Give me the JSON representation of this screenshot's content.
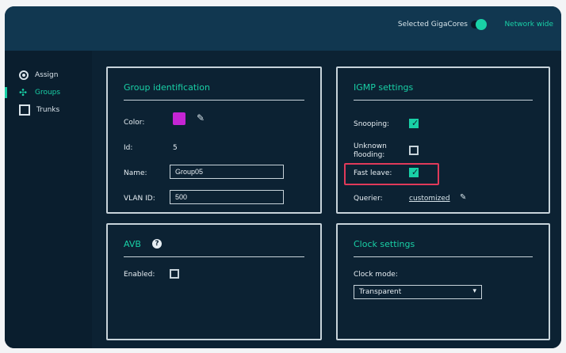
{
  "header": {
    "selected_label": "Selected GigaCores",
    "toggle_label": "Network wide"
  },
  "sidebar": {
    "items": [
      {
        "label": "Assign",
        "icon": "target-icon"
      },
      {
        "label": "Groups",
        "icon": "groups-icon"
      },
      {
        "label": "Trunks",
        "icon": "trunk-icon"
      }
    ],
    "active": "Groups"
  },
  "group_identification": {
    "title": "Group identification",
    "color_label": "Color:",
    "color_value": "#c525d4",
    "id_label": "Id:",
    "id_value": "5",
    "name_label": "Name:",
    "name_value": "Group05",
    "vlan_label": "VLAN ID:",
    "vlan_value": "500"
  },
  "igmp_settings": {
    "title": "IGMP settings",
    "snooping_label": "Snooping:",
    "snooping_checked": true,
    "unknown_flooding_label": "Unknown flooding:",
    "unknown_flooding_checked": false,
    "fast_leave_label": "Fast leave:",
    "fast_leave_checked": true,
    "querier_label": "Querier:",
    "querier_value": "customized"
  },
  "avb": {
    "title": "AVB",
    "enabled_label": "Enabled:",
    "enabled_checked": false
  },
  "clock_settings": {
    "title": "Clock settings",
    "mode_label": "Clock mode:",
    "mode_value": "Transparent"
  }
}
